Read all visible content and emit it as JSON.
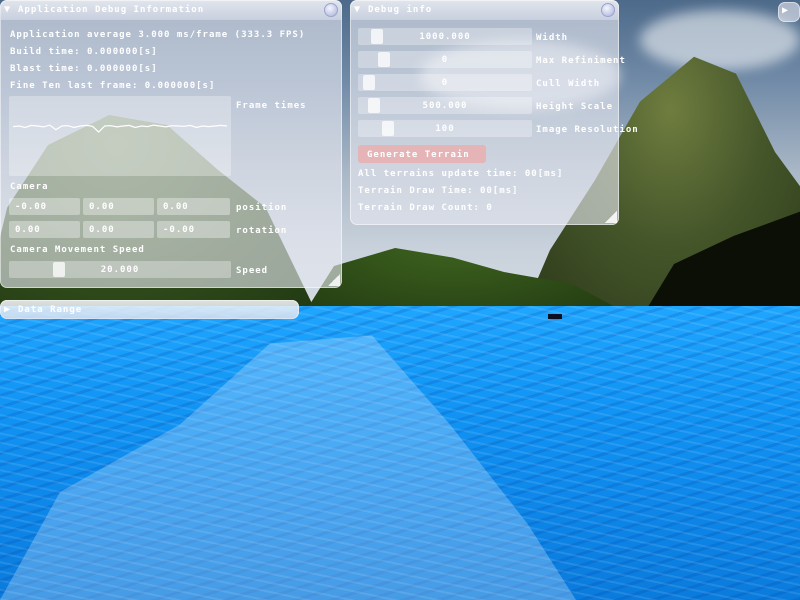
{
  "scene": {
    "description_colors": {
      "water": "#1194f4",
      "sky": "#a9b7c6",
      "hills": "#2f4a1a"
    }
  },
  "app_window": {
    "title": "Application Debug Information",
    "stats_line": "Application average 3.000 ms/frame (333.3 FPS)",
    "build_time": "Build time: 0.000000[s]",
    "blast_time": "Blast time: 0.000000[s]",
    "fine_time": "Fine Ten last frame: 0.000000[s]",
    "plot_label": "Frame times",
    "camera_header": "Camera",
    "position": [
      "-0.00",
      "0.00",
      "0.00"
    ],
    "position_label": "position",
    "rotation": [
      "0.00",
      "0.00",
      "-0.00"
    ],
    "rotation_label": "rotation",
    "speed_header": "Camera Movement Speed",
    "speed_value": "20.000",
    "speed_label": "Speed",
    "frame_times": [
      0.52,
      0.5,
      0.55,
      0.48,
      0.5,
      0.53,
      0.47,
      0.62,
      0.5,
      0.49,
      0.55,
      0.5,
      0.48,
      0.51,
      0.7,
      0.5,
      0.49,
      0.53,
      0.5,
      0.48,
      0.55,
      0.5,
      0.52,
      0.47,
      0.5,
      0.53,
      0.49,
      0.5,
      0.51,
      0.48,
      0.55,
      0.5,
      0.52,
      0.5,
      0.48,
      0.5
    ]
  },
  "debug_window": {
    "title": "Debug info",
    "sliders": [
      {
        "value": "1000.000",
        "label": "Width",
        "knob": 0.07
      },
      {
        "value": "0",
        "label": "Max Refiniment",
        "knob": 0.11
      },
      {
        "value": "0",
        "label": "Cull Width",
        "knob": 0.02
      },
      {
        "value": "500.000",
        "label": "Height Scale",
        "knob": 0.05
      },
      {
        "value": "100",
        "label": "Image Resolution",
        "knob": 0.14
      }
    ],
    "generate_button": "Generate Terrain",
    "time_line": "All terrains update time: 00[ms]",
    "terrain_time": "Terrain Draw Time: 00[ms]",
    "terrain_count": "Terrain Draw Count: 0"
  },
  "data_window": {
    "title": "Data Range"
  }
}
